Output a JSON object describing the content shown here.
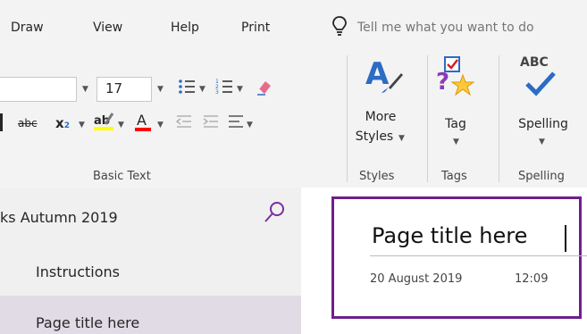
{
  "menu": {
    "items": [
      "Draw",
      "View",
      "Help",
      "Print"
    ],
    "tell_me": "Tell me what you want to do"
  },
  "ribbon": {
    "font_size": "17",
    "strikethrough_label": "abc",
    "subscript_label": "x",
    "subscript_sub": "2",
    "highlight_label": "ab",
    "font_color_label": "A",
    "more_styles_label_line1": "More",
    "more_styles_label_line2": "Styles",
    "tag_label": "Tag",
    "spelling_icon_text": "ABC",
    "spelling_label": "Spelling",
    "groups": {
      "basic_text": "Basic Text",
      "styles": "Styles",
      "tags": "Tags",
      "spelling": "Spelling"
    },
    "colors": {
      "highlight": "#ffff00",
      "font_color": "#ff0000",
      "accent_blue": "#2b6cc4"
    }
  },
  "nav": {
    "section_title": "ks Autumn 2019",
    "pages": [
      "Instructions",
      "Page title here"
    ],
    "selected_index": 1
  },
  "page": {
    "title": "Page title here",
    "date": "20 August 2019",
    "time": "12:09"
  },
  "icons": {
    "lightbulb": "lightbulb-icon",
    "search": "search-icon",
    "bullets": "bullet-list-icon",
    "numbering": "numbered-list-icon",
    "clear_format": "clear-formatting-icon",
    "styles": "styles-icon",
    "tag": "tag-icon",
    "spelling": "spelling-check-icon"
  },
  "accent_colors": {
    "selection": "#e1dbe6",
    "page_border": "#6e1f8c",
    "search_icon": "#7a2e9e"
  }
}
